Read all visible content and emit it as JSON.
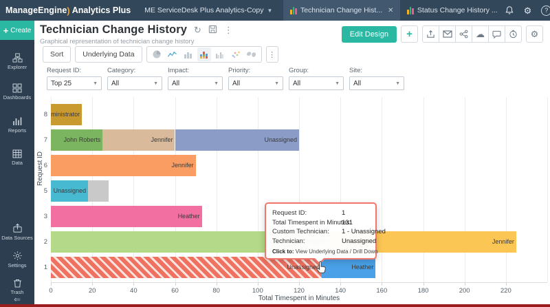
{
  "topbar": {
    "brand_part1": "ManageEngine",
    "brand_swoosh": ")",
    "brand_part2": "Analytics Plus",
    "workspace": "ME ServiceDesk Plus Analytics-Copy",
    "tabs": [
      {
        "label": "Technician Change Hist...",
        "active": true
      },
      {
        "label": "Status Change History ...",
        "active": false
      }
    ]
  },
  "sidebar": {
    "create_label": "Create",
    "items": [
      {
        "label": "Explorer"
      },
      {
        "label": "Dashboards"
      },
      {
        "label": "Reports"
      },
      {
        "label": "Data"
      },
      {
        "label": "Data Sources"
      },
      {
        "label": "Settings"
      },
      {
        "label": "Trash"
      }
    ]
  },
  "header": {
    "title": "Technician Change History",
    "subtitle": "Graphical representation of technician change history",
    "edit_design_label": "Edit Design"
  },
  "toolbar": {
    "sort_label": "Sort",
    "underlying_data_label": "Underlying Data"
  },
  "filters": [
    {
      "label": "Request ID:",
      "value": "Top 25"
    },
    {
      "label": "Category:",
      "value": "All"
    },
    {
      "label": "Impact:",
      "value": "All"
    },
    {
      "label": "Priority:",
      "value": "All"
    },
    {
      "label": "Group:",
      "value": "All"
    },
    {
      "label": "Site:",
      "value": "All"
    }
  ],
  "tooltip": {
    "rows": [
      {
        "label": "Request ID:",
        "value": "1"
      },
      {
        "label": "Total Timespent in Minutes:",
        "value": "131"
      },
      {
        "label": "Custom Technician:",
        "value": "1 - Unassigned"
      },
      {
        "label": "Technician:",
        "value": "Unassigned"
      }
    ],
    "click_to_label": "Click to:",
    "click_to_value": "View Underlying Data / Drill Down"
  },
  "chart_data": {
    "type": "bar",
    "orientation": "horizontal",
    "stacked": true,
    "title": "Technician Change History",
    "xlabel": "Total Timespent in Minutes",
    "ylabel": "Request ID",
    "xlim": [
      0,
      240
    ],
    "xticks": [
      0,
      20,
      40,
      60,
      80,
      100,
      120,
      140,
      160,
      180,
      200,
      220
    ],
    "grid": true,
    "categories": [
      "8",
      "7",
      "6",
      "5",
      "3",
      "2",
      "1"
    ],
    "bars": [
      {
        "category": "8",
        "segments": [
          {
            "label": "administrator",
            "value": 15,
            "color": "#c89a30"
          }
        ]
      },
      {
        "category": "7",
        "segments": [
          {
            "label": "John Roberts",
            "value": 25,
            "color": "#7cb560"
          },
          {
            "label": "Jennifer",
            "value": 35,
            "color": "#d9bb9c"
          },
          {
            "label": "Unassigned",
            "value": 60,
            "color": "#8b9dc7"
          }
        ]
      },
      {
        "category": "6",
        "segments": [
          {
            "label": "Jennifer",
            "value": 70,
            "color": "#f99d62"
          }
        ]
      },
      {
        "category": "5",
        "segments": [
          {
            "label": "Unassigned",
            "value": 18,
            "color": "#47b9d1"
          },
          {
            "label": "",
            "value": 10,
            "color": "#c9c9c9"
          }
        ]
      },
      {
        "category": "3",
        "segments": [
          {
            "label": "Heather",
            "value": 73,
            "color": "#f26fa1"
          }
        ]
      },
      {
        "category": "2",
        "segments": [
          {
            "label": "Unassigned",
            "value": 135,
            "color": "#b4d988"
          },
          {
            "label": "Jennifer",
            "value": 90,
            "color": "#fcc654"
          }
        ]
      },
      {
        "category": "1",
        "segments": [
          {
            "label": "Unassigned",
            "value": 131,
            "color": "#ef7261",
            "hatched": true
          },
          {
            "label": "Heather",
            "value": 26,
            "color": "#4aa1e8"
          }
        ]
      }
    ]
  },
  "colors": {
    "accent_teal": "#2ab8a2",
    "topbar_bg": "#33475b",
    "sidebar_bg": "#2c3e50",
    "tooltip_border": "#f0766b"
  }
}
